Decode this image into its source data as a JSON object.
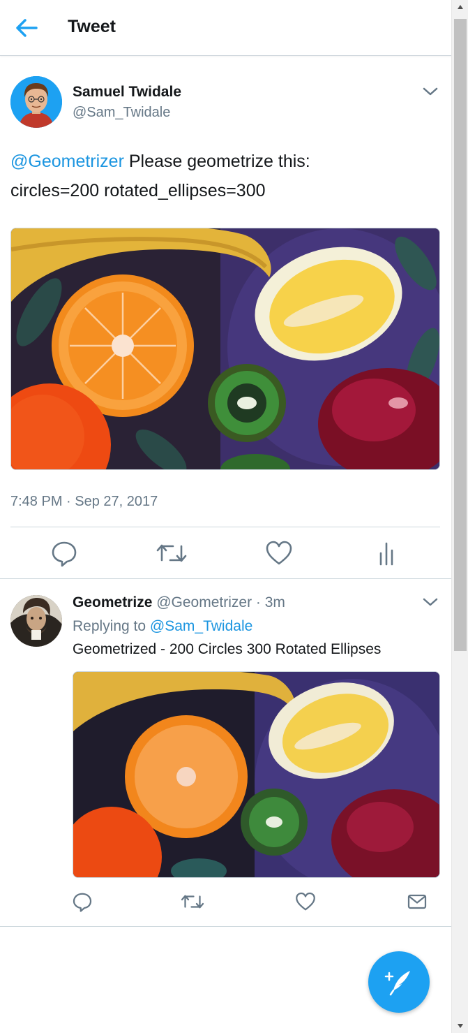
{
  "header": {
    "title": "Tweet",
    "back_icon": "arrow-left-icon",
    "accent": "#1da1f2"
  },
  "tweet": {
    "author_name": "Samuel Twidale",
    "author_handle": "@Sam_Twidale",
    "mention": "@Geometrizer",
    "text_line1": " Please geometrize this:",
    "text_line2": "circles=200 rotated_ellipses=300",
    "timestamp": "7:48 PM · Sep 27, 2017",
    "actions": [
      "reply-icon",
      "retweet-icon",
      "like-icon",
      "analytics-icon"
    ]
  },
  "reply": {
    "author_name": "Geometrize",
    "author_handle_and_time": " @Geometrizer · 3m",
    "replying_prefix": "Replying to ",
    "replying_to": "@Sam_Twidale",
    "text": "Geometrized - 200 Circles 300 Rotated Ellipses",
    "actions": [
      "reply-icon",
      "retweet-icon",
      "like-icon",
      "message-icon"
    ]
  },
  "fab": {
    "icon": "compose-tweet-icon"
  },
  "colors": {
    "link": "#1b95e0",
    "muted": "#657786",
    "border": "#ccd6dd"
  }
}
